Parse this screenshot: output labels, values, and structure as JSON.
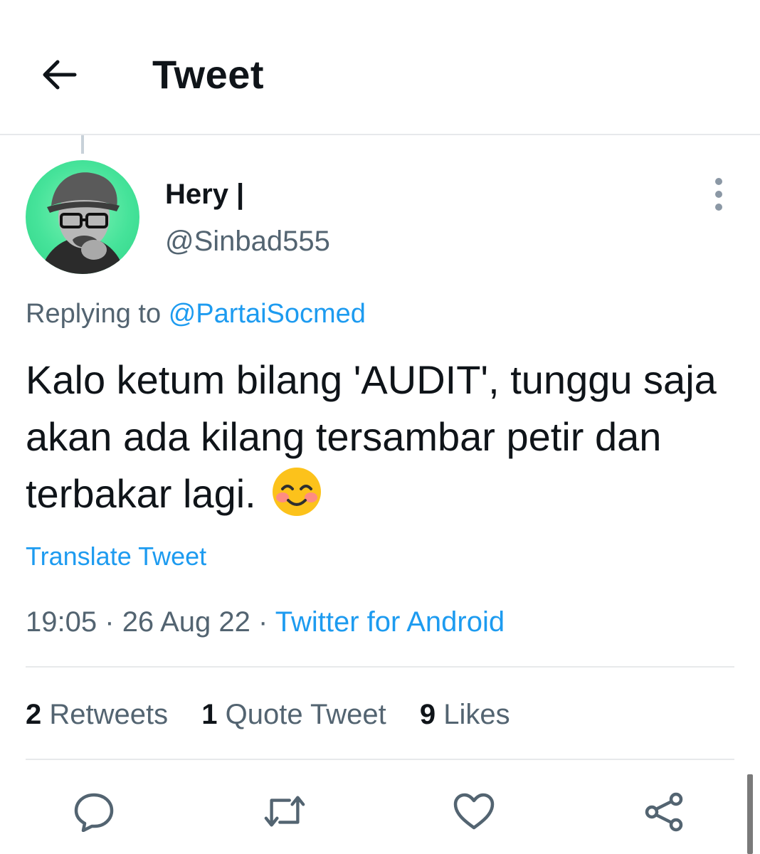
{
  "header": {
    "title": "Tweet",
    "back_icon": "arrow-left-icon"
  },
  "tweet": {
    "author_name": "Hery |",
    "author_handle": "@Sinbad555",
    "replying_prefix": "Replying to",
    "replying_to": "@PartaiSocmed",
    "text": "Kalo ketum bilang 'AUDIT', tunggu saja akan ada kilang tersambar petir dan terbakar lagi.",
    "emoji": "smiling-face-with-smiling-eyes",
    "translate_label": "Translate Tweet",
    "time": "19:05",
    "date": "26 Aug 22",
    "separator": "·",
    "source": "Twitter for Android"
  },
  "stats": {
    "retweets_count": "2",
    "retweets_label": "Retweets",
    "quotes_count": "1",
    "quotes_label": "Quote Tweet",
    "likes_count": "9",
    "likes_label": "Likes"
  },
  "actions": [
    "reply-icon",
    "retweet-icon",
    "like-icon",
    "share-icon"
  ],
  "colors": {
    "accent": "#1d9bf0",
    "text": "#0f1419",
    "muted": "#536471",
    "divider": "#e7e9eb"
  }
}
